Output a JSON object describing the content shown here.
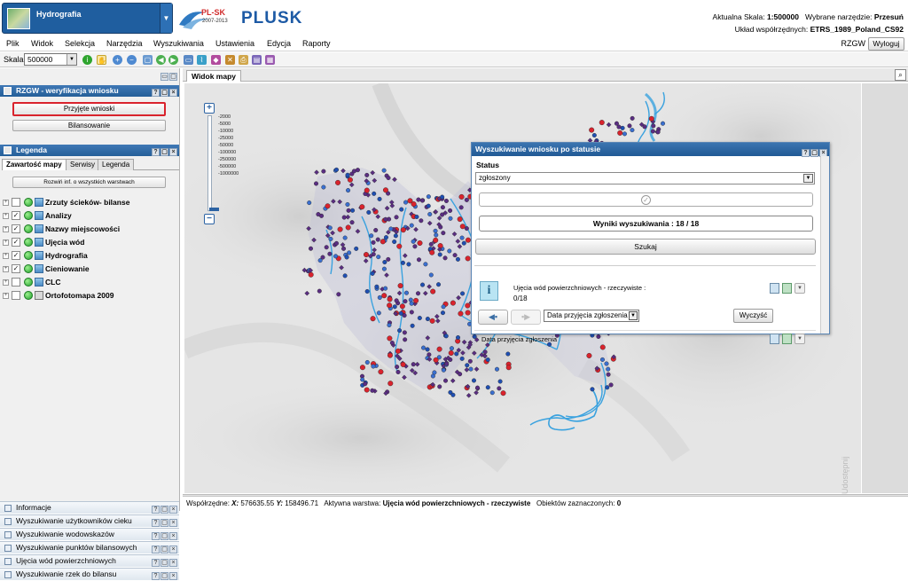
{
  "header": {
    "layer_name": "Hydrografia",
    "logo_plsk": "PL-SK",
    "logo_years": "2007-2013",
    "logo_plusk": "PLUSK",
    "scale_label": "Aktualna Skala:",
    "scale_value": "1:500000",
    "tool_label": "Wybrane narzędzie:",
    "tool_value": "Przesuń",
    "crs_label": "Układ współrzędnych:",
    "crs_value": "ETRS_1989_Poland_CS92"
  },
  "menu": {
    "items": [
      "Plik",
      "Widok",
      "Selekcja",
      "Narzędzia",
      "Wyszukiwania",
      "Ustawienia",
      "Edycja",
      "Raporty"
    ],
    "rzgw": "RZGW",
    "logout": "Wyloguj"
  },
  "toolbar": {
    "scale_label": "Skala:",
    "scale_value": "500000"
  },
  "left": {
    "panel1_title": "RZGW - weryfikacja wniosku",
    "btn_accepted": "Przyjęte wnioski",
    "btn_balance": "Bilansowanie",
    "legend_title": "Legenda",
    "tabs": [
      "Zawartość mapy",
      "Serwisy",
      "Legenda"
    ],
    "expand_btn": "Rozwiń inf. o wszystkich warstwach",
    "layers": [
      {
        "label": "Zrzuty ścieków- bilanse",
        "checked": false
      },
      {
        "label": "Analizy",
        "checked": true
      },
      {
        "label": "Nazwy miejscowości",
        "checked": true
      },
      {
        "label": "Ujęcia wód",
        "checked": true
      },
      {
        "label": "Hydrografia",
        "checked": true
      },
      {
        "label": "Cieniowanie",
        "checked": true
      },
      {
        "label": "CLC",
        "checked": false
      },
      {
        "label": "Ortofotomapa 2009",
        "checked": false
      }
    ],
    "bottom": [
      "Informacje",
      "Wyszukiwanie użytkowników cieku",
      "Wyszukiwanie wodowskazów",
      "Wyszukiwanie punktów bilansowych",
      "Ujęcia wód powierzchniowych",
      "Wyszukiwanie rzek do bilansu"
    ]
  },
  "map": {
    "tab": "Widok mapy",
    "zoom_labels": [
      "-2000",
      "-5000",
      "-10000",
      "-25000",
      "-50000",
      "-100000",
      "-250000",
      "-500000",
      "-1000000"
    ],
    "watermark": "Udostępnij"
  },
  "statusbar": {
    "coords_label": "Współrzędne:",
    "x_label": "X:",
    "x_value": "576635.55",
    "y_label": "Y:",
    "y_value": "158496.71",
    "active_label": "Aktywna warstwa:",
    "active_value": "Ujęcia wód powierzchniowych - rzeczywiste",
    "selected_label": "Obiektów zaznaczonych:",
    "selected_value": "0"
  },
  "dialog": {
    "title": "Wyszukiwanie wniosku po statusie",
    "status_label": "Status",
    "status_value": "zgłoszony",
    "results": "Wyniki wyszukiwania : 18 / 18",
    "search_btn": "Szukaj",
    "result_title": "Ujęcia wód powierzchniowych - rzeczywiste :",
    "result_count": "0/18",
    "sort_value": "Data przyjęcia zgłoszenia",
    "clear_btn": "Wyczyść",
    "result2": "Data przyjęcia zgłoszenia"
  },
  "colors": {
    "header_blue": "#255f99",
    "accent_red": "#d9232d",
    "point_purple": "#5a2d82",
    "river_blue": "#3aa2df"
  }
}
